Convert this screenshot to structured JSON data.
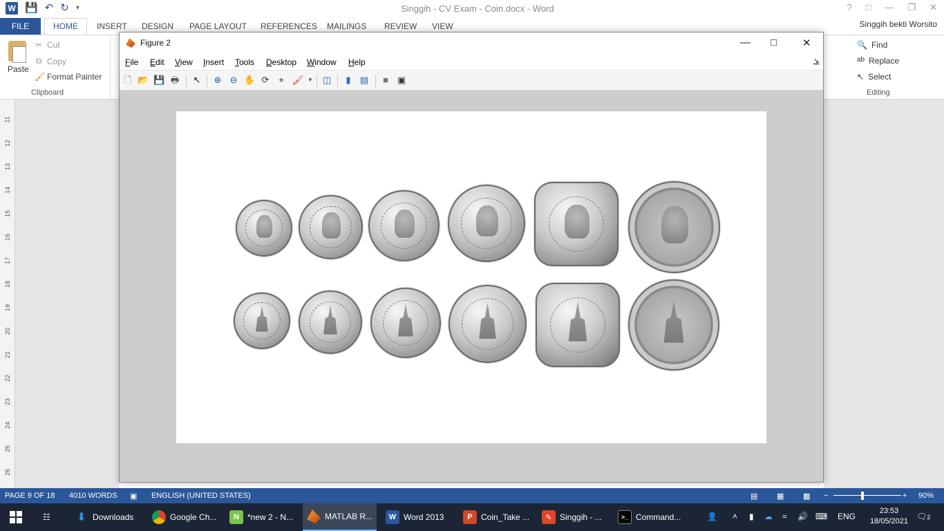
{
  "word": {
    "doc_title": "Singgih - CV Exam - Coin.docx - Word",
    "user": "Singgih bekti Worsito",
    "tabs": [
      "FILE",
      "HOME",
      "INSERT",
      "DESIGN",
      "PAGE LAYOUT",
      "REFERENCES",
      "MAILINGS",
      "REVIEW",
      "VIEW"
    ],
    "clipboard": {
      "paste": "Paste",
      "cut": "Cut",
      "copy": "Copy",
      "format_painter": "Format Painter",
      "group": "Clipboard"
    },
    "editing": {
      "find": "Find",
      "replace": "Replace",
      "select": "Select",
      "group": "Editing"
    },
    "ruler_numbers": [
      "11",
      "12",
      "13",
      "14",
      "15",
      "16",
      "17",
      "18",
      "19",
      "20",
      "21",
      "22",
      "23",
      "24",
      "25",
      "26"
    ],
    "status": {
      "page": "PAGE 9 OF 18",
      "words": "4010 WORDS",
      "language": "ENGLISH (UNITED STATES)",
      "zoom": "90%"
    }
  },
  "figure": {
    "title": "Figure 2",
    "menus": [
      "File",
      "Edit",
      "View",
      "Insert",
      "Tools",
      "Desktop",
      "Window",
      "Help"
    ],
    "toolbar_icons": [
      "new-figure-icon",
      "open-file-icon",
      "save-icon",
      "print-icon",
      "edit-plot-arrow-icon",
      "zoom-in-icon",
      "zoom-out-icon",
      "pan-hand-icon",
      "rotate-3d-icon",
      "data-cursor-icon",
      "brush-icon",
      "link-plot-icon",
      "colorbar-icon",
      "legend-icon",
      "hide-plot-tools-icon",
      "show-plot-tools-icon"
    ]
  },
  "taskbar": {
    "items": [
      "Downloads",
      "Google Ch...",
      "*new 2 - N...",
      "MATLAB R...",
      "Word 2013",
      "Coin_Take ...",
      "Singgih - ...",
      "Command..."
    ],
    "language": "ENG",
    "time": "23:53",
    "date": "18/05/2021",
    "notifications": "2"
  }
}
